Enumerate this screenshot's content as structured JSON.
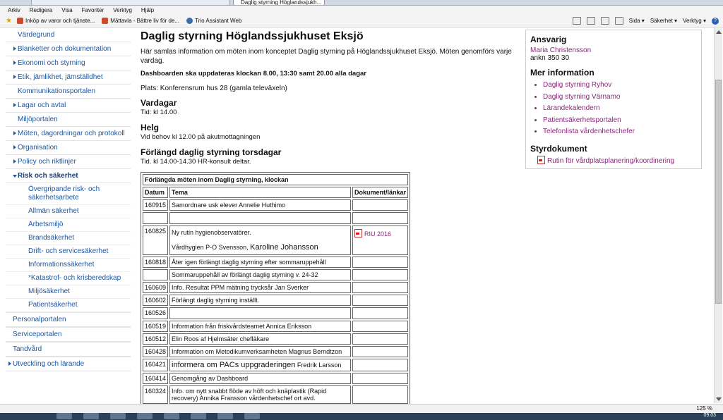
{
  "browser": {
    "active_tab_title": "Daglig styrning Höglandssjukh...",
    "menu": [
      "Arkiv",
      "Redigera",
      "Visa",
      "Favoriter",
      "Verktyg",
      "Hjälp"
    ],
    "favorites": [
      "Inköp av varor och tjänste...",
      "Mättavla - Bättre liv för de...",
      "Trio Assistant Web"
    ],
    "tools": [
      "Sida ▾",
      "Säkerhet ▾",
      "Verktyg ▾"
    ],
    "zoom": "125 %"
  },
  "sidebar": {
    "top": [
      {
        "label": "Värdegrund",
        "tri": false
      },
      {
        "label": "Blanketter och dokumentation",
        "tri": true
      },
      {
        "label": "Ekonomi och styrning",
        "tri": true
      },
      {
        "label": "Etik, jämlikhet, jämställdhet",
        "tri": true
      },
      {
        "label": "Kommunikationsportalen",
        "tri": false
      },
      {
        "label": "Lagar och avtal",
        "tri": true
      },
      {
        "label": "Miljöportalen",
        "tri": false
      },
      {
        "label": "Möten, dagordningar och protokoll",
        "tri": true
      },
      {
        "label": "Organisation",
        "tri": true
      },
      {
        "label": "Policy och riktlinjer",
        "tri": true
      }
    ],
    "open_section": "Risk och säkerhet",
    "sub_items": [
      "Övergripande risk- och säkerhetsarbete",
      "Allmän säkerhet",
      "Arbetsmiljö",
      "Brandsäkerhet",
      "Drift- och servicesäkerhet",
      "Informationssäkerhet",
      "*Katastrof- och krisberedskap",
      "Miljösäkerhet",
      "Patientsäkerhet"
    ],
    "bottom": [
      {
        "label": "Personalportalen",
        "tri": false
      },
      {
        "label": "Serviceportalen",
        "tri": false
      },
      {
        "label": "Tandvård",
        "tri": false
      },
      {
        "label": "Utveckling och lärande",
        "tri": true
      }
    ]
  },
  "main": {
    "title": "Daglig styrning Höglandssjukhuset Eksjö",
    "intro": "Här samlas information om möten inom konceptet Daglig styrning på Höglandssjukhuset Eksjö. Möten genomförs varje vardag.",
    "dashboard_note": "Dashboarden ska uppdateras klockan 8.00, 13:30 samt 20.00 alla dagar",
    "place": "Plats: Konferensrum hus 28 (gamla televäxeln)",
    "sections": [
      {
        "heading": "Vardagar",
        "text": "Tid: kl 14.00"
      },
      {
        "heading": "Helg",
        "text": "Vid behov kl 12.00 på akutmottagningen"
      },
      {
        "heading": "Förlängd daglig styrning torsdagar",
        "text": "Tid.  kl 14.00-14.30 HR-konsult  deltar."
      }
    ],
    "table": {
      "caption": "Förlängda möten inom Daglig styrning,  klockan",
      "headers": [
        "Datum",
        "Tema",
        "Dokument/länkar"
      ],
      "rows": [
        {
          "date": "160915",
          "theme": "Samordnare usk elever Annelie Huthimo",
          "link": ""
        },
        {
          "date": "",
          "theme": "",
          "link": ""
        },
        {
          "date": "160825",
          "theme": "Ny rutin hygienobservatörer.",
          "theme2a": "Vårdhygien  P-O Svensson, ",
          "theme2b": "Karoline Johansson",
          "link": "RIU 2016"
        },
        {
          "date": "160818",
          "theme": "Åter igen förlängt daglig styrning efter sommaruppehåll",
          "link": ""
        },
        {
          "date": "",
          "theme": "Sommaruppehåll av förlängt daglig styrning v. 24-32",
          "link": ""
        },
        {
          "date": "160609",
          "theme": "Info. Resultat PPM mätning trycksår  Jan Sverker",
          "link": ""
        },
        {
          "date": "160602",
          "theme": "Förlängt daglig styrning inställt.",
          "link": ""
        },
        {
          "date": "160526",
          "theme": "",
          "link": ""
        },
        {
          "date": "160519",
          "theme": "Information från friskvårdsteamet Annica Eriksson",
          "link": ""
        },
        {
          "date": "160512",
          "theme": "Elin Roos af Hjelmsäter chefläkare",
          "link": ""
        },
        {
          "date": "160428",
          "theme": "Information om Metodikumverksamheten Magnus Berndtzon",
          "link": ""
        },
        {
          "date": "160421",
          "theme_big": "informera om PACs uppgraderingen",
          "theme": " Fredrik Larsson",
          "link": ""
        },
        {
          "date": "160414",
          "theme": "Genomgång av Dashboard",
          "link": ""
        },
        {
          "date": "160324",
          "theme": "Info. om nytt snabbt flöde  av höft och knäplastik  (Rapid recovery) Annika Fransson vårdenhetschef ort avd.",
          "link": ""
        }
      ]
    }
  },
  "right": {
    "responsible_heading": "Ansvarig",
    "responsible_name": "Maria Christensson",
    "responsible_phone": "ankn 350 30",
    "more_heading": "Mer information",
    "more_links": [
      "Daglig styrning Ryhov",
      "Daglig styrning Värnamo",
      "Lärandekalendern",
      "Patientsäkerhetsportalen",
      "Telefonlista vårdenhetschefer"
    ],
    "docs_heading": "Styrdokument",
    "docs_links": [
      "Rutin för vårdplatsplanering/koordinering"
    ]
  },
  "taskbar": {
    "clock": "09:03"
  }
}
